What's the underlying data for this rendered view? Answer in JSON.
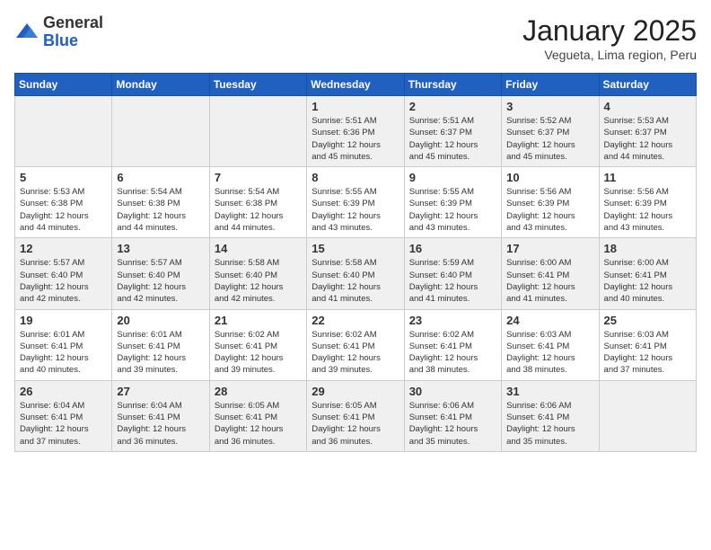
{
  "header": {
    "logo_general": "General",
    "logo_blue": "Blue",
    "month_title": "January 2025",
    "subtitle": "Vegueta, Lima region, Peru"
  },
  "days_of_week": [
    "Sunday",
    "Monday",
    "Tuesday",
    "Wednesday",
    "Thursday",
    "Friday",
    "Saturday"
  ],
  "weeks": [
    [
      {
        "day": "",
        "text": ""
      },
      {
        "day": "",
        "text": ""
      },
      {
        "day": "",
        "text": ""
      },
      {
        "day": "1",
        "text": "Sunrise: 5:51 AM\nSunset: 6:36 PM\nDaylight: 12 hours\nand 45 minutes."
      },
      {
        "day": "2",
        "text": "Sunrise: 5:51 AM\nSunset: 6:37 PM\nDaylight: 12 hours\nand 45 minutes."
      },
      {
        "day": "3",
        "text": "Sunrise: 5:52 AM\nSunset: 6:37 PM\nDaylight: 12 hours\nand 45 minutes."
      },
      {
        "day": "4",
        "text": "Sunrise: 5:53 AM\nSunset: 6:37 PM\nDaylight: 12 hours\nand 44 minutes."
      }
    ],
    [
      {
        "day": "5",
        "text": "Sunrise: 5:53 AM\nSunset: 6:38 PM\nDaylight: 12 hours\nand 44 minutes."
      },
      {
        "day": "6",
        "text": "Sunrise: 5:54 AM\nSunset: 6:38 PM\nDaylight: 12 hours\nand 44 minutes."
      },
      {
        "day": "7",
        "text": "Sunrise: 5:54 AM\nSunset: 6:38 PM\nDaylight: 12 hours\nand 44 minutes."
      },
      {
        "day": "8",
        "text": "Sunrise: 5:55 AM\nSunset: 6:39 PM\nDaylight: 12 hours\nand 43 minutes."
      },
      {
        "day": "9",
        "text": "Sunrise: 5:55 AM\nSunset: 6:39 PM\nDaylight: 12 hours\nand 43 minutes."
      },
      {
        "day": "10",
        "text": "Sunrise: 5:56 AM\nSunset: 6:39 PM\nDaylight: 12 hours\nand 43 minutes."
      },
      {
        "day": "11",
        "text": "Sunrise: 5:56 AM\nSunset: 6:39 PM\nDaylight: 12 hours\nand 43 minutes."
      }
    ],
    [
      {
        "day": "12",
        "text": "Sunrise: 5:57 AM\nSunset: 6:40 PM\nDaylight: 12 hours\nand 42 minutes."
      },
      {
        "day": "13",
        "text": "Sunrise: 5:57 AM\nSunset: 6:40 PM\nDaylight: 12 hours\nand 42 minutes."
      },
      {
        "day": "14",
        "text": "Sunrise: 5:58 AM\nSunset: 6:40 PM\nDaylight: 12 hours\nand 42 minutes."
      },
      {
        "day": "15",
        "text": "Sunrise: 5:58 AM\nSunset: 6:40 PM\nDaylight: 12 hours\nand 41 minutes."
      },
      {
        "day": "16",
        "text": "Sunrise: 5:59 AM\nSunset: 6:40 PM\nDaylight: 12 hours\nand 41 minutes."
      },
      {
        "day": "17",
        "text": "Sunrise: 6:00 AM\nSunset: 6:41 PM\nDaylight: 12 hours\nand 41 minutes."
      },
      {
        "day": "18",
        "text": "Sunrise: 6:00 AM\nSunset: 6:41 PM\nDaylight: 12 hours\nand 40 minutes."
      }
    ],
    [
      {
        "day": "19",
        "text": "Sunrise: 6:01 AM\nSunset: 6:41 PM\nDaylight: 12 hours\nand 40 minutes."
      },
      {
        "day": "20",
        "text": "Sunrise: 6:01 AM\nSunset: 6:41 PM\nDaylight: 12 hours\nand 39 minutes."
      },
      {
        "day": "21",
        "text": "Sunrise: 6:02 AM\nSunset: 6:41 PM\nDaylight: 12 hours\nand 39 minutes."
      },
      {
        "day": "22",
        "text": "Sunrise: 6:02 AM\nSunset: 6:41 PM\nDaylight: 12 hours\nand 39 minutes."
      },
      {
        "day": "23",
        "text": "Sunrise: 6:02 AM\nSunset: 6:41 PM\nDaylight: 12 hours\nand 38 minutes."
      },
      {
        "day": "24",
        "text": "Sunrise: 6:03 AM\nSunset: 6:41 PM\nDaylight: 12 hours\nand 38 minutes."
      },
      {
        "day": "25",
        "text": "Sunrise: 6:03 AM\nSunset: 6:41 PM\nDaylight: 12 hours\nand 37 minutes."
      }
    ],
    [
      {
        "day": "26",
        "text": "Sunrise: 6:04 AM\nSunset: 6:41 PM\nDaylight: 12 hours\nand 37 minutes."
      },
      {
        "day": "27",
        "text": "Sunrise: 6:04 AM\nSunset: 6:41 PM\nDaylight: 12 hours\nand 36 minutes."
      },
      {
        "day": "28",
        "text": "Sunrise: 6:05 AM\nSunset: 6:41 PM\nDaylight: 12 hours\nand 36 minutes."
      },
      {
        "day": "29",
        "text": "Sunrise: 6:05 AM\nSunset: 6:41 PM\nDaylight: 12 hours\nand 36 minutes."
      },
      {
        "day": "30",
        "text": "Sunrise: 6:06 AM\nSunset: 6:41 PM\nDaylight: 12 hours\nand 35 minutes."
      },
      {
        "day": "31",
        "text": "Sunrise: 6:06 AM\nSunset: 6:41 PM\nDaylight: 12 hours\nand 35 minutes."
      },
      {
        "day": "",
        "text": ""
      }
    ]
  ]
}
